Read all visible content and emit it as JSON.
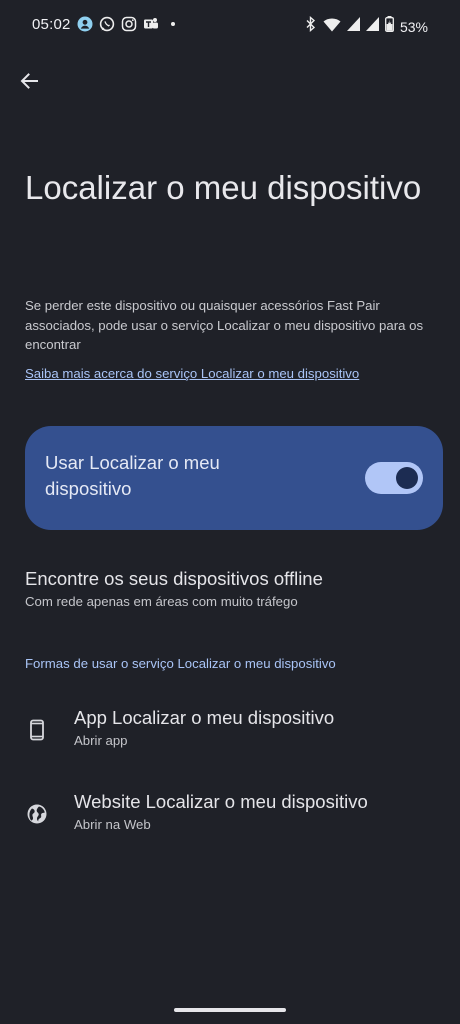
{
  "status_bar": {
    "time": "05:02",
    "app_icons": [
      "contact-icon",
      "whatsapp-icon",
      "instagram-icon",
      "teams-icon",
      "dot-icon"
    ],
    "system_icons": [
      "bluetooth-icon",
      "wifi-icon",
      "signal-icon",
      "signal-icon",
      "battery-charging-icon"
    ],
    "battery": "53%"
  },
  "header": {
    "back_icon": "arrow-back-icon",
    "title": "Localizar o meu dispositivo"
  },
  "description": "Se perder este dispositivo ou quaisquer acessórios Fast Pair associados, pode usar o serviço Localizar o meu dispositivo para os encontrar",
  "learn_more_link": "Saiba mais acerca do serviço Localizar o meu dispositivo",
  "main_toggle": {
    "label": "Usar Localizar o meu dispositivo",
    "enabled": true,
    "accent": "#34508f"
  },
  "offline_devices": {
    "title": "Encontre os seus dispositivos offline",
    "subtitle": "Com rede apenas em áreas com muito tráfego"
  },
  "ways_section": {
    "header": "Formas de usar o serviço Localizar o meu dispositivo",
    "items": [
      {
        "icon": "phone-icon",
        "title": "App Localizar o meu dispositivo",
        "subtitle": "Abrir app"
      },
      {
        "icon": "globe-icon",
        "title": "Website Localizar o meu dispositivo",
        "subtitle": "Abrir na Web"
      }
    ]
  }
}
